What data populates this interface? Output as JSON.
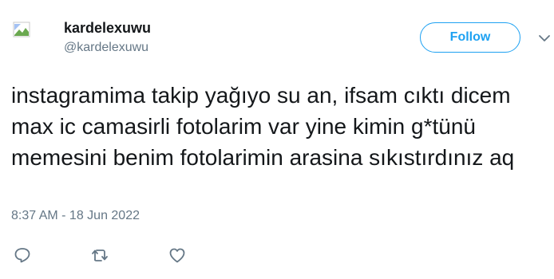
{
  "user": {
    "display_name": "kardelexuwu",
    "handle": "@kardelexuwu",
    "avatar_icon": "broken-image-icon"
  },
  "follow": {
    "label": "Follow",
    "color": "#1da1f2"
  },
  "menu": {
    "icon": "chevron-down-icon"
  },
  "tweet": {
    "text": "instagramima takip yağıyo su an, ifsam cıktı dicem max ic camasirli fotolarim var yine kimin g*tünü memesini benim fotolarimin arasina sıkıstırdınız aq",
    "timestamp": "8:37 AM - 18 Jun 2022"
  },
  "actions": {
    "icons": [
      "reply-icon",
      "retweet-icon",
      "like-icon"
    ],
    "icon_color": "#657786"
  }
}
